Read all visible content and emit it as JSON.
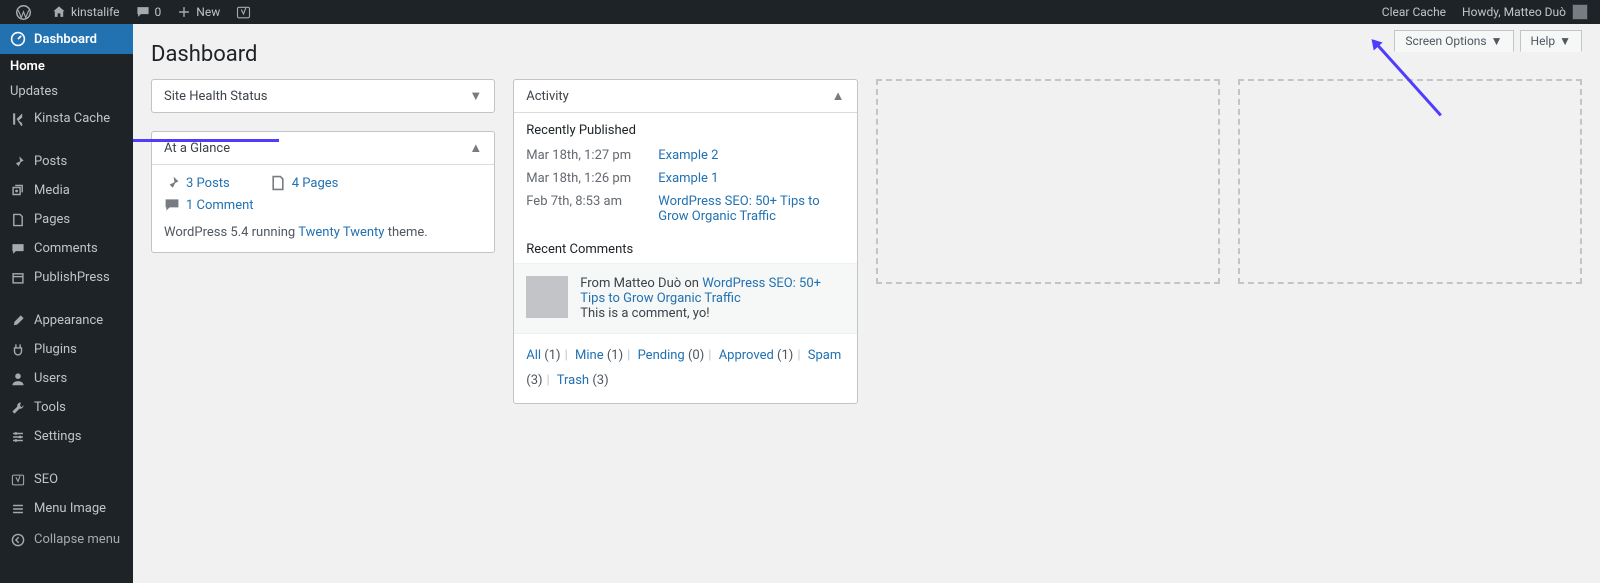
{
  "adminbar": {
    "site_name": "kinstalife",
    "comments_count": "0",
    "new_label": "New",
    "clear_cache_label": "Clear Cache",
    "howdy_prefix": "Howdy, ",
    "user_name": "Matteo Duò"
  },
  "tabs": {
    "screen_options": "Screen Options",
    "help": "Help"
  },
  "page_title": "Dashboard",
  "menu": {
    "dashboard": "Dashboard",
    "home": "Home",
    "updates": "Updates",
    "kinsta_cache": "Kinsta Cache",
    "posts": "Posts",
    "media": "Media",
    "pages": "Pages",
    "comments": "Comments",
    "publishpress": "PublishPress",
    "appearance": "Appearance",
    "plugins": "Plugins",
    "users": "Users",
    "tools": "Tools",
    "settings": "Settings",
    "seo": "SEO",
    "menu_image": "Menu Image",
    "collapse": "Collapse menu"
  },
  "site_health": {
    "title": "Site Health Status"
  },
  "glance": {
    "title": "At a Glance",
    "posts": "3 Posts",
    "pages": "4 Pages",
    "comments": "1 Comment",
    "version_prefix": "WordPress 5.4 running ",
    "theme": "Twenty Twenty",
    "version_suffix": " theme."
  },
  "activity": {
    "title": "Activity",
    "recently_published": "Recently Published",
    "rows": [
      {
        "date": "Mar 18th, 1:27 pm",
        "title": "Example 2"
      },
      {
        "date": "Mar 18th, 1:26 pm",
        "title": "Example 1"
      },
      {
        "date": "Feb 7th, 8:53 am",
        "title": "WordPress SEO: 50+ Tips to Grow Organic Traffic"
      }
    ],
    "recent_comments": "Recent Comments",
    "comment": {
      "from_prefix": "From ",
      "author": "Matteo Duò",
      "on_text": " on ",
      "post": "WordPress SEO: 50+ Tips to Grow Organic Traffic",
      "body": "This is a comment, yo!"
    },
    "filters": {
      "all": "All",
      "all_c": "(1)",
      "mine": "Mine",
      "mine_c": "(1)",
      "pending": "Pending",
      "pending_c": "(0)",
      "approved": "Approved",
      "approved_c": "(1)",
      "spam": "Spam",
      "spam_c": "(3)",
      "trash": "Trash",
      "trash_c": "(3)"
    }
  }
}
